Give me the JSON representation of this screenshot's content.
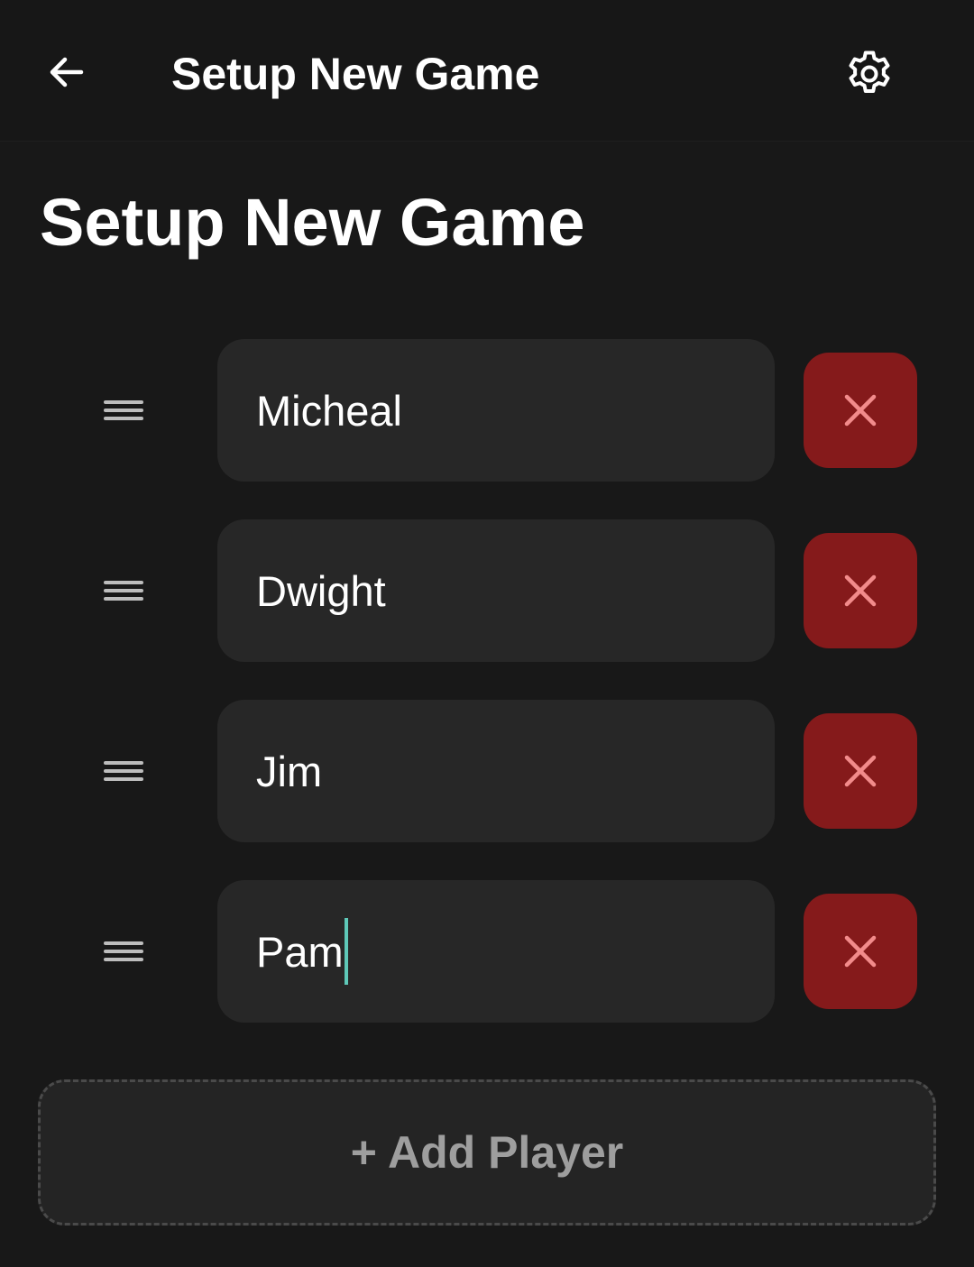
{
  "app_bar": {
    "title": "Setup New Game",
    "back_icon": "arrow-left-icon",
    "settings_icon": "gear-icon"
  },
  "page": {
    "title": "Setup New Game"
  },
  "players": [
    {
      "name": "Micheal"
    },
    {
      "name": "Dwight"
    },
    {
      "name": "Jim"
    },
    {
      "name": "Pam",
      "focused": true
    }
  ],
  "add_player_label": "+ Add Player",
  "colors": {
    "background": "#181818",
    "field": "#272727",
    "remove_button": "#851a1b",
    "remove_icon": "#f28b8b",
    "caret": "#5ec8b8",
    "add_button_text": "#9e9e9e"
  }
}
